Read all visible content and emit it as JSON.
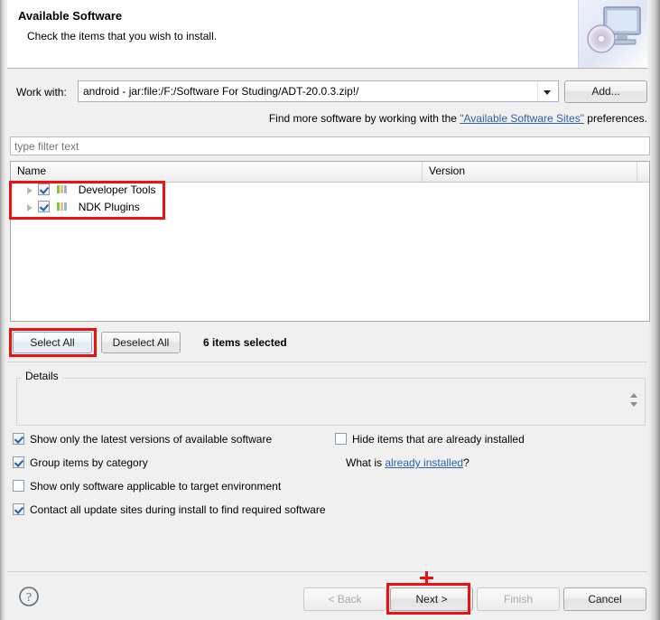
{
  "window": {
    "title": "Available Software",
    "subtitle": "Check the items that you wish to install.",
    "banner_icon": "computer-with-disc-icon"
  },
  "work_with": {
    "label": "Work with:",
    "value": "android - jar:file:/F:/Software For Studing/ADT-20.0.3.zip!/",
    "dropdown_icon": "chevron-down-icon",
    "add_button": "Add..."
  },
  "find_more": {
    "prefix": "Find more software by working with the ",
    "link": "\"Available Software Sites\"",
    "suffix": " preferences."
  },
  "filter": {
    "placeholder": "type filter text",
    "value": ""
  },
  "table": {
    "columns": [
      "Name",
      "Version",
      ""
    ],
    "rows": [
      {
        "name": "Developer Tools",
        "version": "",
        "checked": true,
        "expandable": true,
        "icon": "category-icon"
      },
      {
        "name": "NDK Plugins",
        "version": "",
        "checked": true,
        "expandable": true,
        "icon": "category-icon"
      }
    ]
  },
  "selection": {
    "select_all": "Select All",
    "deselect_all": "Deselect All",
    "status": "6 items selected"
  },
  "details": {
    "legend": "Details",
    "content": "",
    "spinner_icon": "spinner-up-down-icon"
  },
  "options": {
    "left": [
      {
        "label": "Show only the latest versions of available software",
        "checked": true
      },
      {
        "label": "Group items by category",
        "checked": true
      },
      {
        "label": "Show only software applicable to target environment",
        "checked": false
      },
      {
        "label": "Contact all update sites during install to find required software",
        "checked": true
      }
    ],
    "right": [
      {
        "label": "Hide items that are already installed",
        "checked": false
      }
    ],
    "what_is": {
      "prefix": "What is ",
      "link": "already installed",
      "suffix": "?"
    }
  },
  "footer": {
    "help_icon": "help-question-icon",
    "buttons": [
      {
        "label": "< Back",
        "enabled": false
      },
      {
        "label": "Next >",
        "enabled": true
      },
      {
        "label": "Finish",
        "enabled": false
      },
      {
        "label": "Cancel",
        "enabled": true
      }
    ]
  },
  "annotations": {
    "highlight_color": "#ee1111",
    "boxes": [
      "tree-items",
      "select-all-button",
      "next-button"
    ],
    "cursor": "plus-crosshair"
  }
}
